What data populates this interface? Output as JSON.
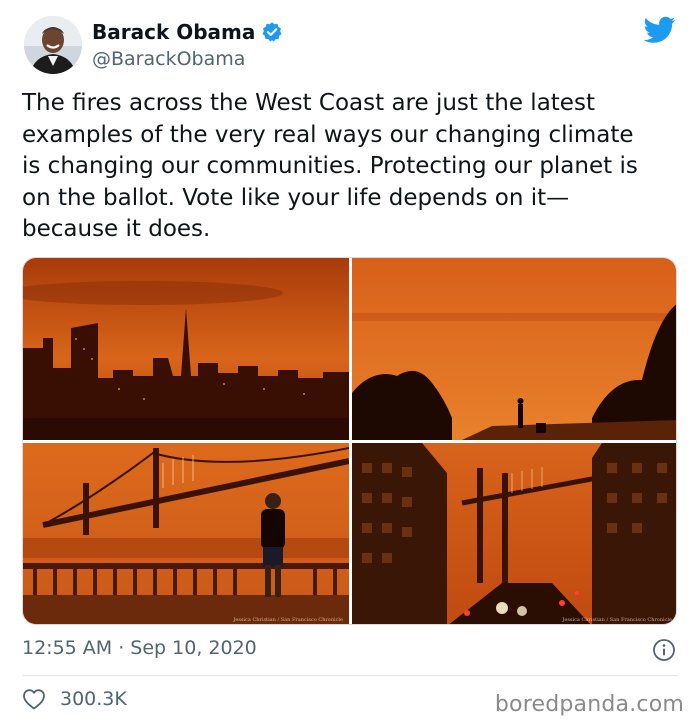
{
  "author": {
    "name": "Barack Obama",
    "handle": "@BarackObama"
  },
  "icons": {
    "verified": "verified-badge-icon",
    "platform": "twitter-bird-icon",
    "info": "info-icon",
    "like": "heart-icon"
  },
  "tweet": {
    "lines": [
      "The fires across the West Coast are just the latest",
      "examples of the very real ways our changing climate",
      "is changing our communities. Protecting our planet is",
      "on the ballot. Vote like your life depends on it—",
      "because it does."
    ]
  },
  "media": {
    "photo_credit_1": "Jessica Christian / San Francisco Chronicle",
    "photo_credit_2": "Jessica Christian / San Francisco Chronicle"
  },
  "meta": {
    "timestamp": "12:55 AM · Sep 10, 2020",
    "likes": "300.3K"
  },
  "watermark": "boredpanda.com",
  "colors": {
    "twitter_blue": "#1d9bf0",
    "sky_orange": "#d9651a",
    "text_gray": "#536471"
  }
}
